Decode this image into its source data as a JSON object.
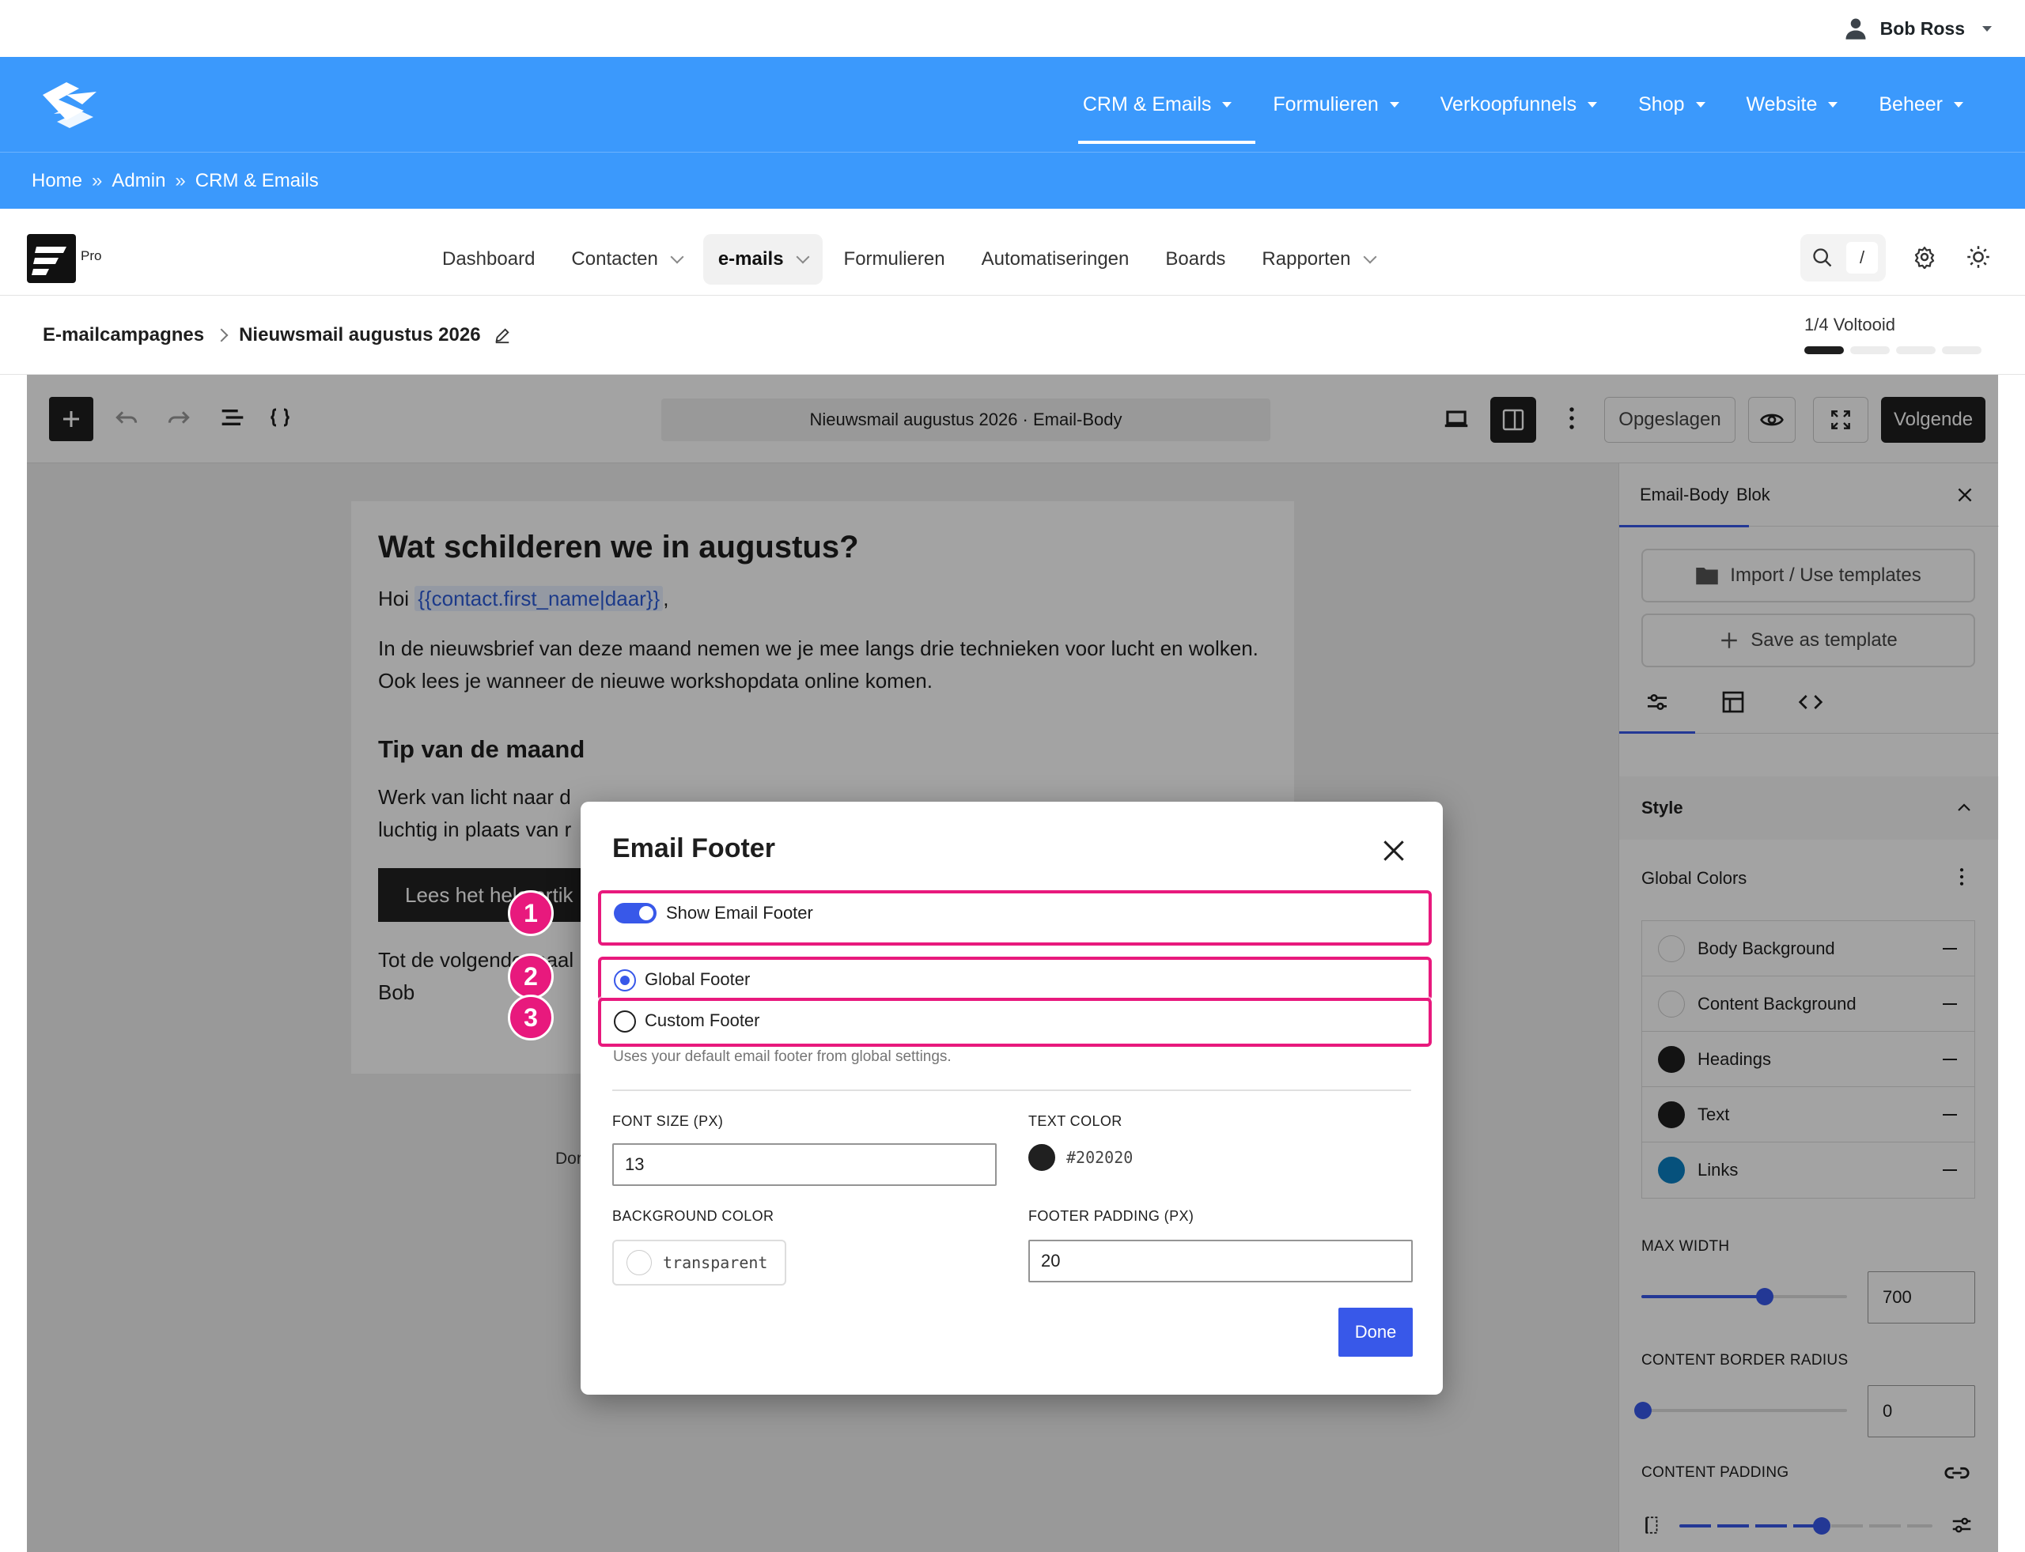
{
  "admin_bar": {
    "user_name": "Bob Ross"
  },
  "site_nav": {
    "items": [
      {
        "label": "CRM & Emails"
      },
      {
        "label": "Formulieren"
      },
      {
        "label": "Verkoopfunnels"
      },
      {
        "label": "Shop"
      },
      {
        "label": "Website"
      },
      {
        "label": "Beheer"
      }
    ],
    "active": "CRM & Emails"
  },
  "breadcrumb": {
    "items": [
      "Home",
      "Admin",
      "CRM & Emails"
    ],
    "separator": "»"
  },
  "app_header": {
    "badge": "Pro",
    "nav": [
      {
        "label": "Dashboard"
      },
      {
        "label": "Contacten"
      },
      {
        "label": "e-mails"
      },
      {
        "label": "Formulieren"
      },
      {
        "label": "Automatiseringen"
      },
      {
        "label": "Boards"
      },
      {
        "label": "Rapporten"
      }
    ],
    "search_shortcut": "/"
  },
  "campaign": {
    "parent": "E-mailcampagnes",
    "name": "Nieuwsmail augustus 2026",
    "progress_label": "1/4 Voltooid",
    "progress_done": 1,
    "progress_total": 4
  },
  "editor_toolbar": {
    "doc_title": "Nieuwsmail augustus 2026 · Email-Body",
    "saved_label": "Opgeslagen",
    "next_label": "Volgende"
  },
  "email": {
    "heading": "Wat schilderen we in augustus?",
    "greeting_prefix": "Hoi",
    "merge_tag": "{{contact.first_name|daar}}",
    "greeting_suffix": ",",
    "intro": "In de nieuwsbrief van deze maand nemen we je mee langs drie technieken voor lucht en wolken. Ook lees je wanneer de nieuwe workshopdata online komen.",
    "subheading": "Tip van de maand",
    "tip_line1": "Werk van licht naar d",
    "tip_line2": "luchtig in plaats van r",
    "button_label": "Lees het hele artik",
    "signoff_line1": "Tot de volgende maal",
    "signoff_line2": "Bob",
    "footer_fragment": "Dor"
  },
  "sidebar": {
    "tabs": [
      {
        "label": "Email-Body"
      },
      {
        "label": "Blok"
      }
    ],
    "import_label": "Import / Use templates",
    "save_template_label": "Save as template",
    "style_section": "Style",
    "global_colors_label": "Global Colors",
    "colors": [
      {
        "name": "Body Background",
        "value": "#ffffff"
      },
      {
        "name": "Content Background",
        "value": "#ffffff"
      },
      {
        "name": "Headings",
        "value": "#1e1e1e"
      },
      {
        "name": "Text",
        "value": "#1e1e1e"
      },
      {
        "name": "Links",
        "value": "#0a7fc2"
      }
    ],
    "max_width_label": "MAX WIDTH",
    "max_width_value": "700",
    "border_radius_label": "CONTENT BORDER RADIUS",
    "border_radius_value": "0",
    "content_padding_label": "CONTENT PADDING"
  },
  "modal": {
    "title": "Email Footer",
    "show_footer_label": "Show Email Footer",
    "show_footer_on": true,
    "option_global": "Global Footer",
    "option_custom": "Custom Footer",
    "selected_option": "Global Footer",
    "help_text": "Uses your default email footer from global settings.",
    "font_size_label": "FONT SIZE (PX)",
    "font_size_value": "13",
    "text_color_label": "TEXT COLOR",
    "text_color_value": "#202020",
    "bg_color_label": "BACKGROUND COLOR",
    "bg_color_value": "transparent",
    "padding_label": "FOOTER PADDING (PX)",
    "padding_value": "20",
    "done_label": "Done"
  },
  "annotations": [
    {
      "number": "1",
      "target": "Show Email Footer"
    },
    {
      "number": "2",
      "target": "Global Footer"
    },
    {
      "number": "3",
      "target": "Custom Footer"
    }
  ],
  "colors": {
    "site_blue": "#3b99fc",
    "accent": "#3858e9",
    "highlight": "#e8197d"
  }
}
